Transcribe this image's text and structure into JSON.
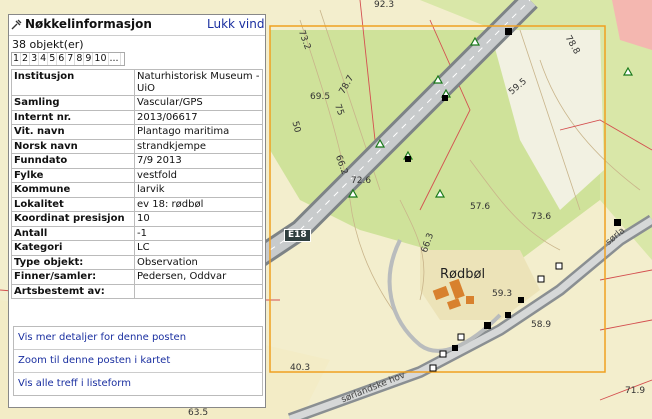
{
  "panel": {
    "title": "Nøkkelinformasjon",
    "close_link": "Lukk vindu",
    "count": "38 objekt(er)",
    "pages": [
      "1",
      "2",
      "3",
      "4",
      "5",
      "6",
      "7",
      "8",
      "9",
      "10",
      "..."
    ],
    "rows": [
      {
        "label": "Institusjon",
        "value": "Naturhistorisk Museum - UiO"
      },
      {
        "label": "Samling",
        "value": "Vascular/GPS"
      },
      {
        "label": "Internt nr.",
        "value": "2013/06617"
      },
      {
        "label": "Vit. navn",
        "value": "Plantago maritima"
      },
      {
        "label": "Norsk navn",
        "value": "strandkjempe"
      },
      {
        "label": "Funndato",
        "value": "7/9 2013"
      },
      {
        "label": "Fylke",
        "value": "vestfold"
      },
      {
        "label": "Kommune",
        "value": "larvik"
      },
      {
        "label": "Lokalitet",
        "value": "ev 18: rødbøl"
      },
      {
        "label": "Koordinat presisjon",
        "value": "10"
      },
      {
        "label": "Antall",
        "value": "-1"
      },
      {
        "label": "Kategori",
        "value": "LC"
      },
      {
        "label": "Type objekt:",
        "value": "Observation"
      },
      {
        "label": "Finner/samler:",
        "value": "Pedersen, Oddvar"
      },
      {
        "label": "Artsbestemt av:",
        "value": ""
      }
    ],
    "actions": [
      "Vis mer detaljer for denne posten",
      "Zoom til denne posten i kartet",
      "Vis alle treff i listeform"
    ]
  },
  "map": {
    "place_name": "Rødbøl",
    "road_badge": "E18",
    "road_name_1": "sørlandske hov",
    "road_name_2": "sørla",
    "contours": [
      "92.3",
      "73.2",
      "78.8",
      "69.5",
      "78.7",
      "75",
      "59.5",
      "50",
      "66.2",
      "72.6",
      "57.6",
      "73.6",
      "66.3",
      "59.3",
      "58.9",
      "40.3",
      "71.9",
      "63.5"
    ],
    "colors": {
      "selection": "#f0a020",
      "marker": "#000000",
      "triangle": "#1a7a1a",
      "road": "#8a8f92"
    }
  }
}
